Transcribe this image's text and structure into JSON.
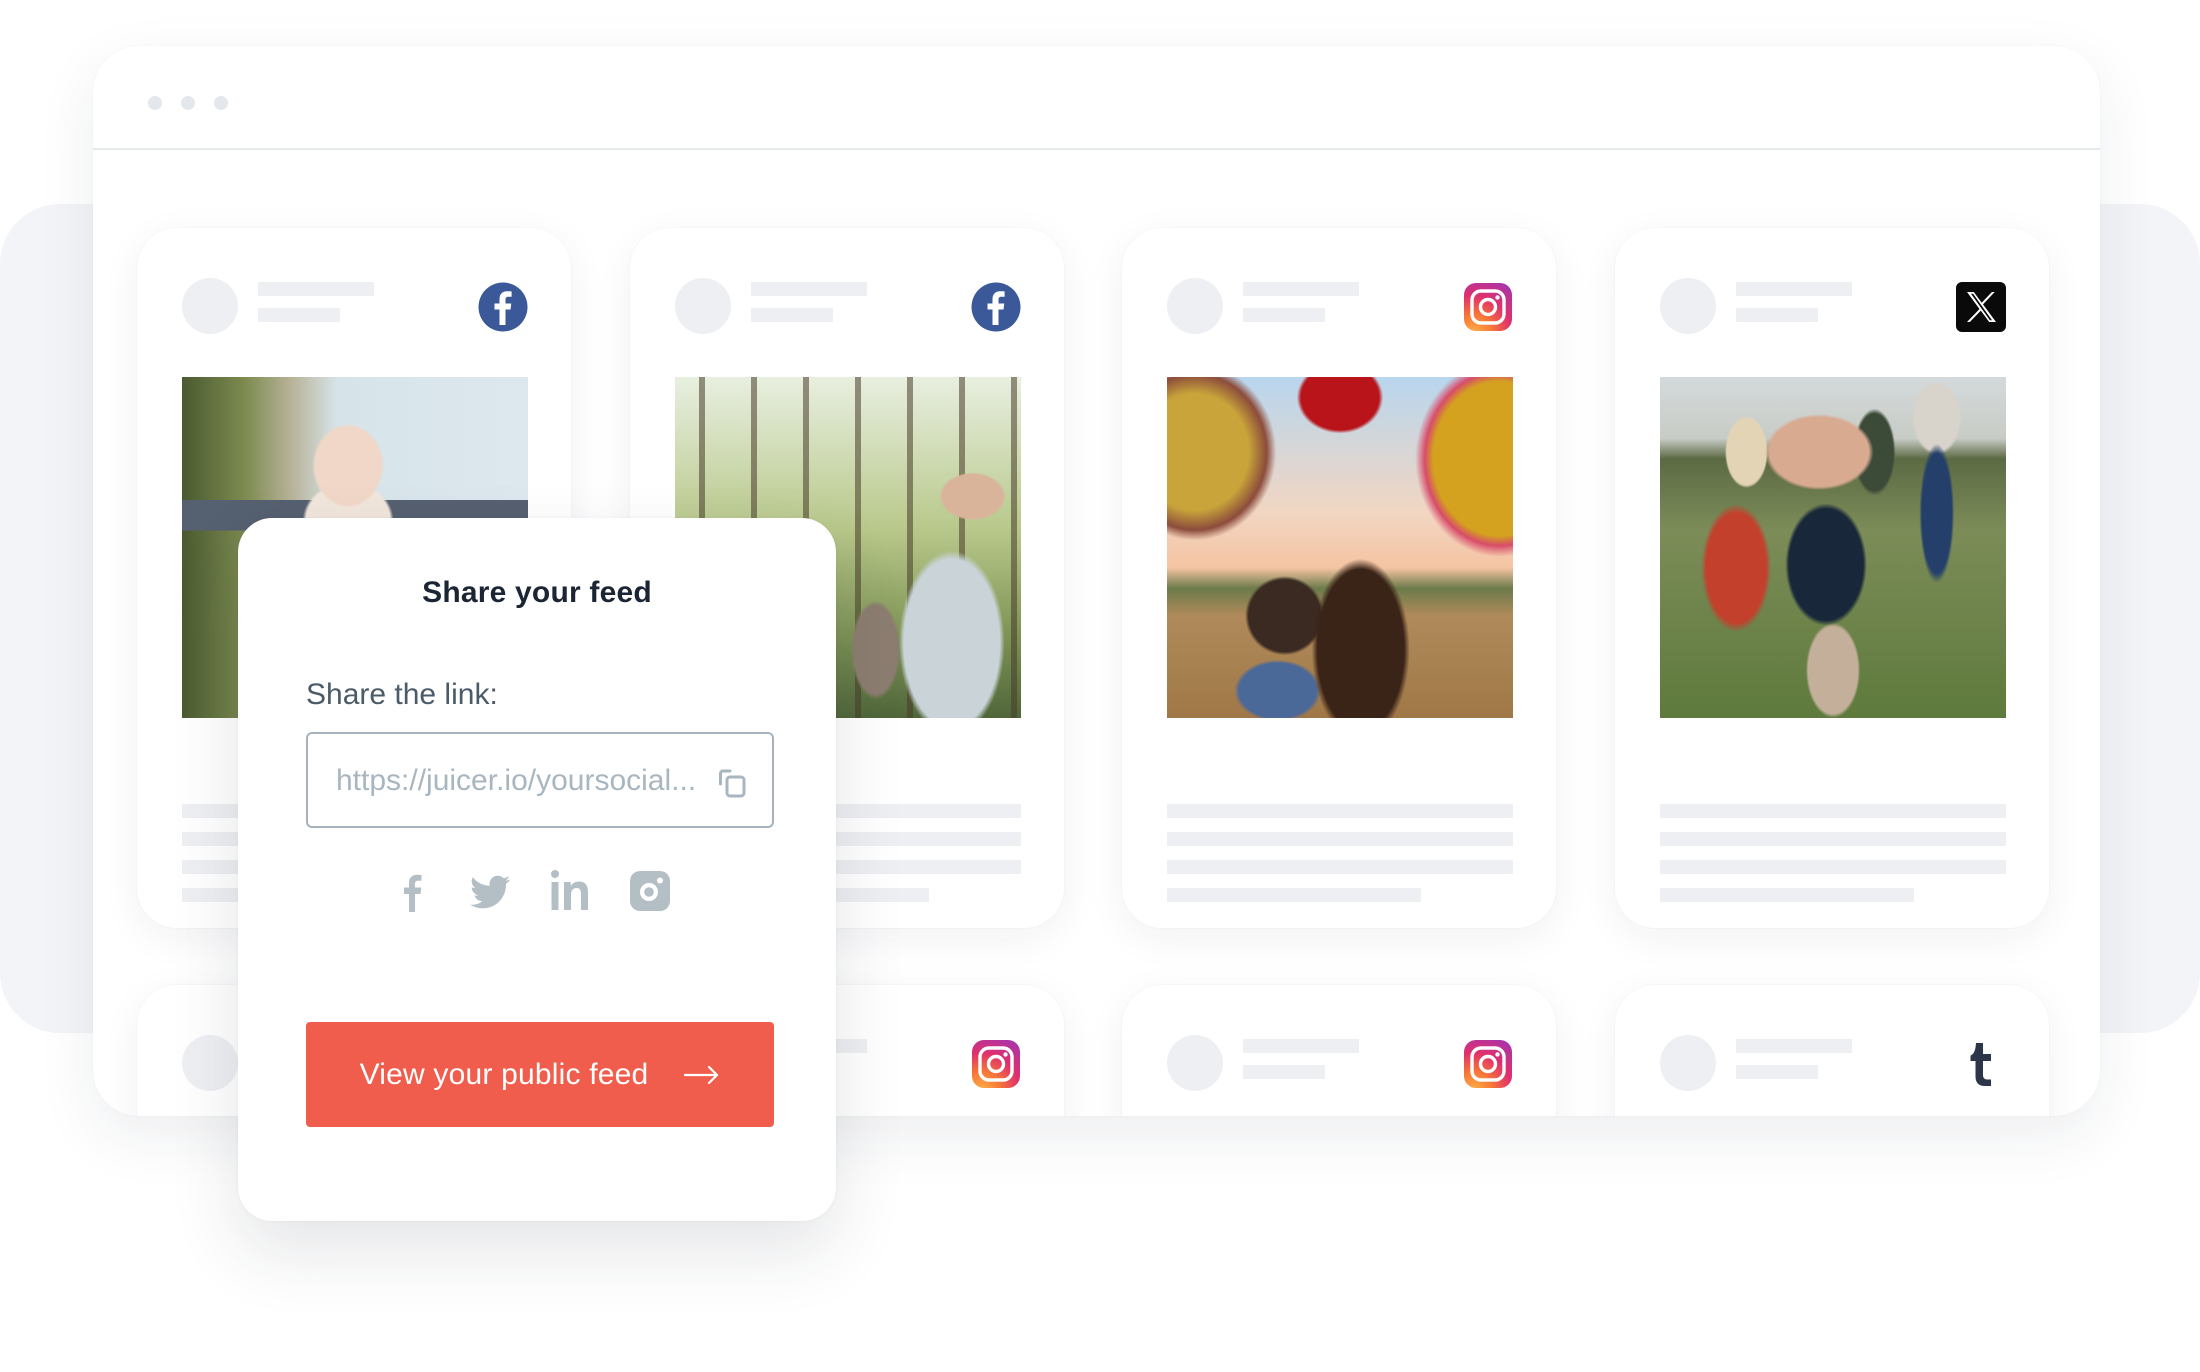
{
  "browser": {
    "window_dots": [
      "dot",
      "dot",
      "dot"
    ]
  },
  "feed": {
    "cards": [
      {
        "network": "facebook",
        "icon": "facebook-icon",
        "photo": "baby-on-shoulders",
        "row": 1
      },
      {
        "network": "facebook",
        "icon": "facebook-icon",
        "photo": "family-walk-forest",
        "row": 1
      },
      {
        "network": "instagram",
        "icon": "instagram-icon",
        "photo": "hot-air-balloons",
        "row": 1
      },
      {
        "network": "x",
        "icon": "x-icon",
        "photo": "family-in-field",
        "row": 1
      },
      {
        "network": "instagram",
        "icon": "instagram-icon",
        "row": 2
      },
      {
        "network": "instagram",
        "icon": "instagram-icon",
        "row": 2
      },
      {
        "network": "tumblr",
        "icon": "tumblr-icon",
        "row": 2
      }
    ]
  },
  "share_modal": {
    "title": "Share your feed",
    "link_label": "Share the link:",
    "link_value": "https://juicer.io/yoursocial...",
    "copy_icon": "copy-icon",
    "social_buttons": [
      {
        "name": "facebook",
        "icon": "facebook-icon"
      },
      {
        "name": "twitter",
        "icon": "twitter-icon"
      },
      {
        "name": "linkedin",
        "icon": "linkedin-icon"
      },
      {
        "name": "instagram",
        "icon": "instagram-icon"
      }
    ],
    "cta_label": "View your public feed",
    "cta_icon": "arrow-right-icon"
  },
  "colors": {
    "accent": "#f05d4c",
    "facebook": "#3b5998",
    "title_text": "#1b2533",
    "social_icon_gray": "#b4bfc5",
    "placeholder_gray": "#eeeff3"
  }
}
